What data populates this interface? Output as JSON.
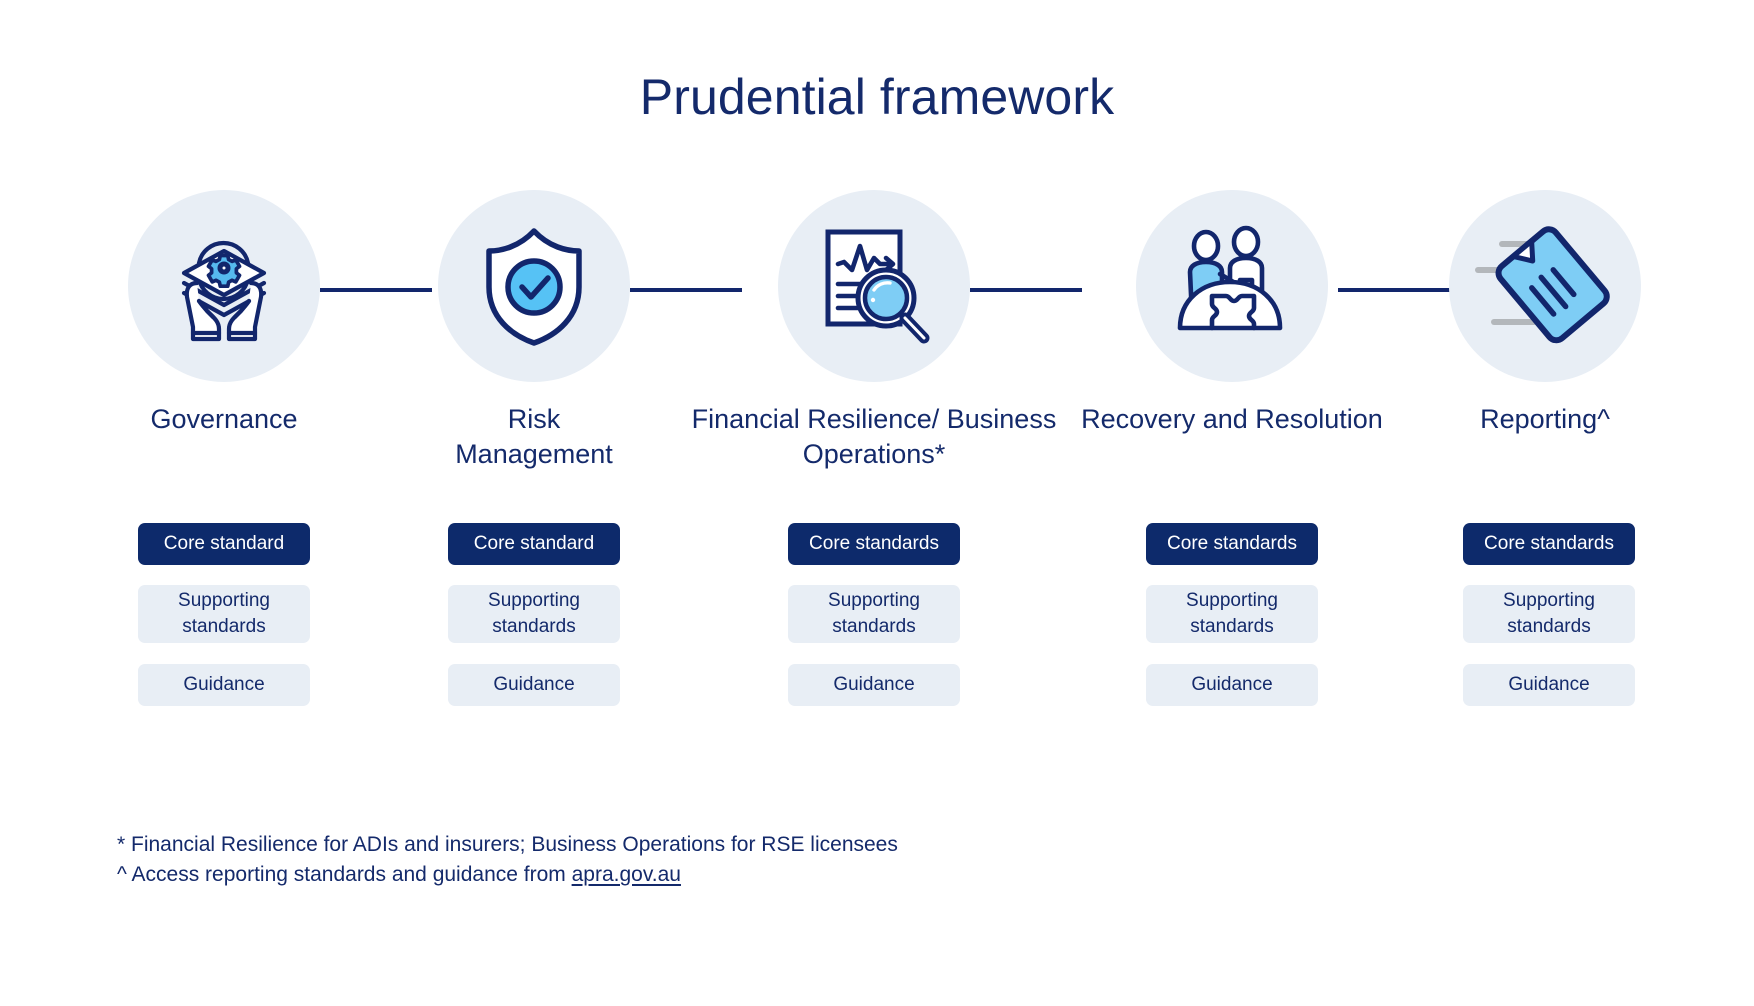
{
  "header": {
    "title": "Prudential framework"
  },
  "colors": {
    "navy": "#142a6b",
    "core_box_bg": "#0d2a6b",
    "soft_box_bg": "#e8eef5",
    "circle_bg": "#e8eef5",
    "accent_light_blue": "#7ecdf2",
    "connector": "#12266c",
    "motion_line_gray": "#b3b7bb"
  },
  "columns": [
    {
      "id": "governance",
      "icon": "hands-holding-layers-gear-icon",
      "label": "Governance",
      "boxes": {
        "core": "Core standard",
        "supporting": "Supporting standards",
        "guidance": "Guidance"
      }
    },
    {
      "id": "risk-management",
      "icon": "shield-check-icon",
      "label": "Risk Management",
      "boxes": {
        "core": "Core standard",
        "supporting": "Supporting standards",
        "guidance": "Guidance"
      }
    },
    {
      "id": "financial-resilience-business-operations",
      "icon": "document-magnifier-icon",
      "label": "Financial Resilience/ Business Operations*",
      "boxes": {
        "core": "Core standards",
        "supporting": "Supporting standards",
        "guidance": "Guidance"
      }
    },
    {
      "id": "recovery-and-resolution",
      "icon": "people-puzzle-hill-icon",
      "label": "Recovery and Resolution",
      "boxes": {
        "core": "Core standards",
        "supporting": "Supporting standards",
        "guidance": "Guidance"
      }
    },
    {
      "id": "reporting",
      "icon": "flying-document-icon",
      "label": "Reporting^",
      "boxes": {
        "core": "Core standards",
        "supporting": "Supporting standards",
        "guidance": "Guidance"
      }
    }
  ],
  "footnotes": {
    "line1": "* Financial Resilience for ADIs and insurers; Business Operations for RSE licensees",
    "line2_prefix": "^ Access reporting standards and guidance from ",
    "line2_link": "apra.gov.au"
  }
}
